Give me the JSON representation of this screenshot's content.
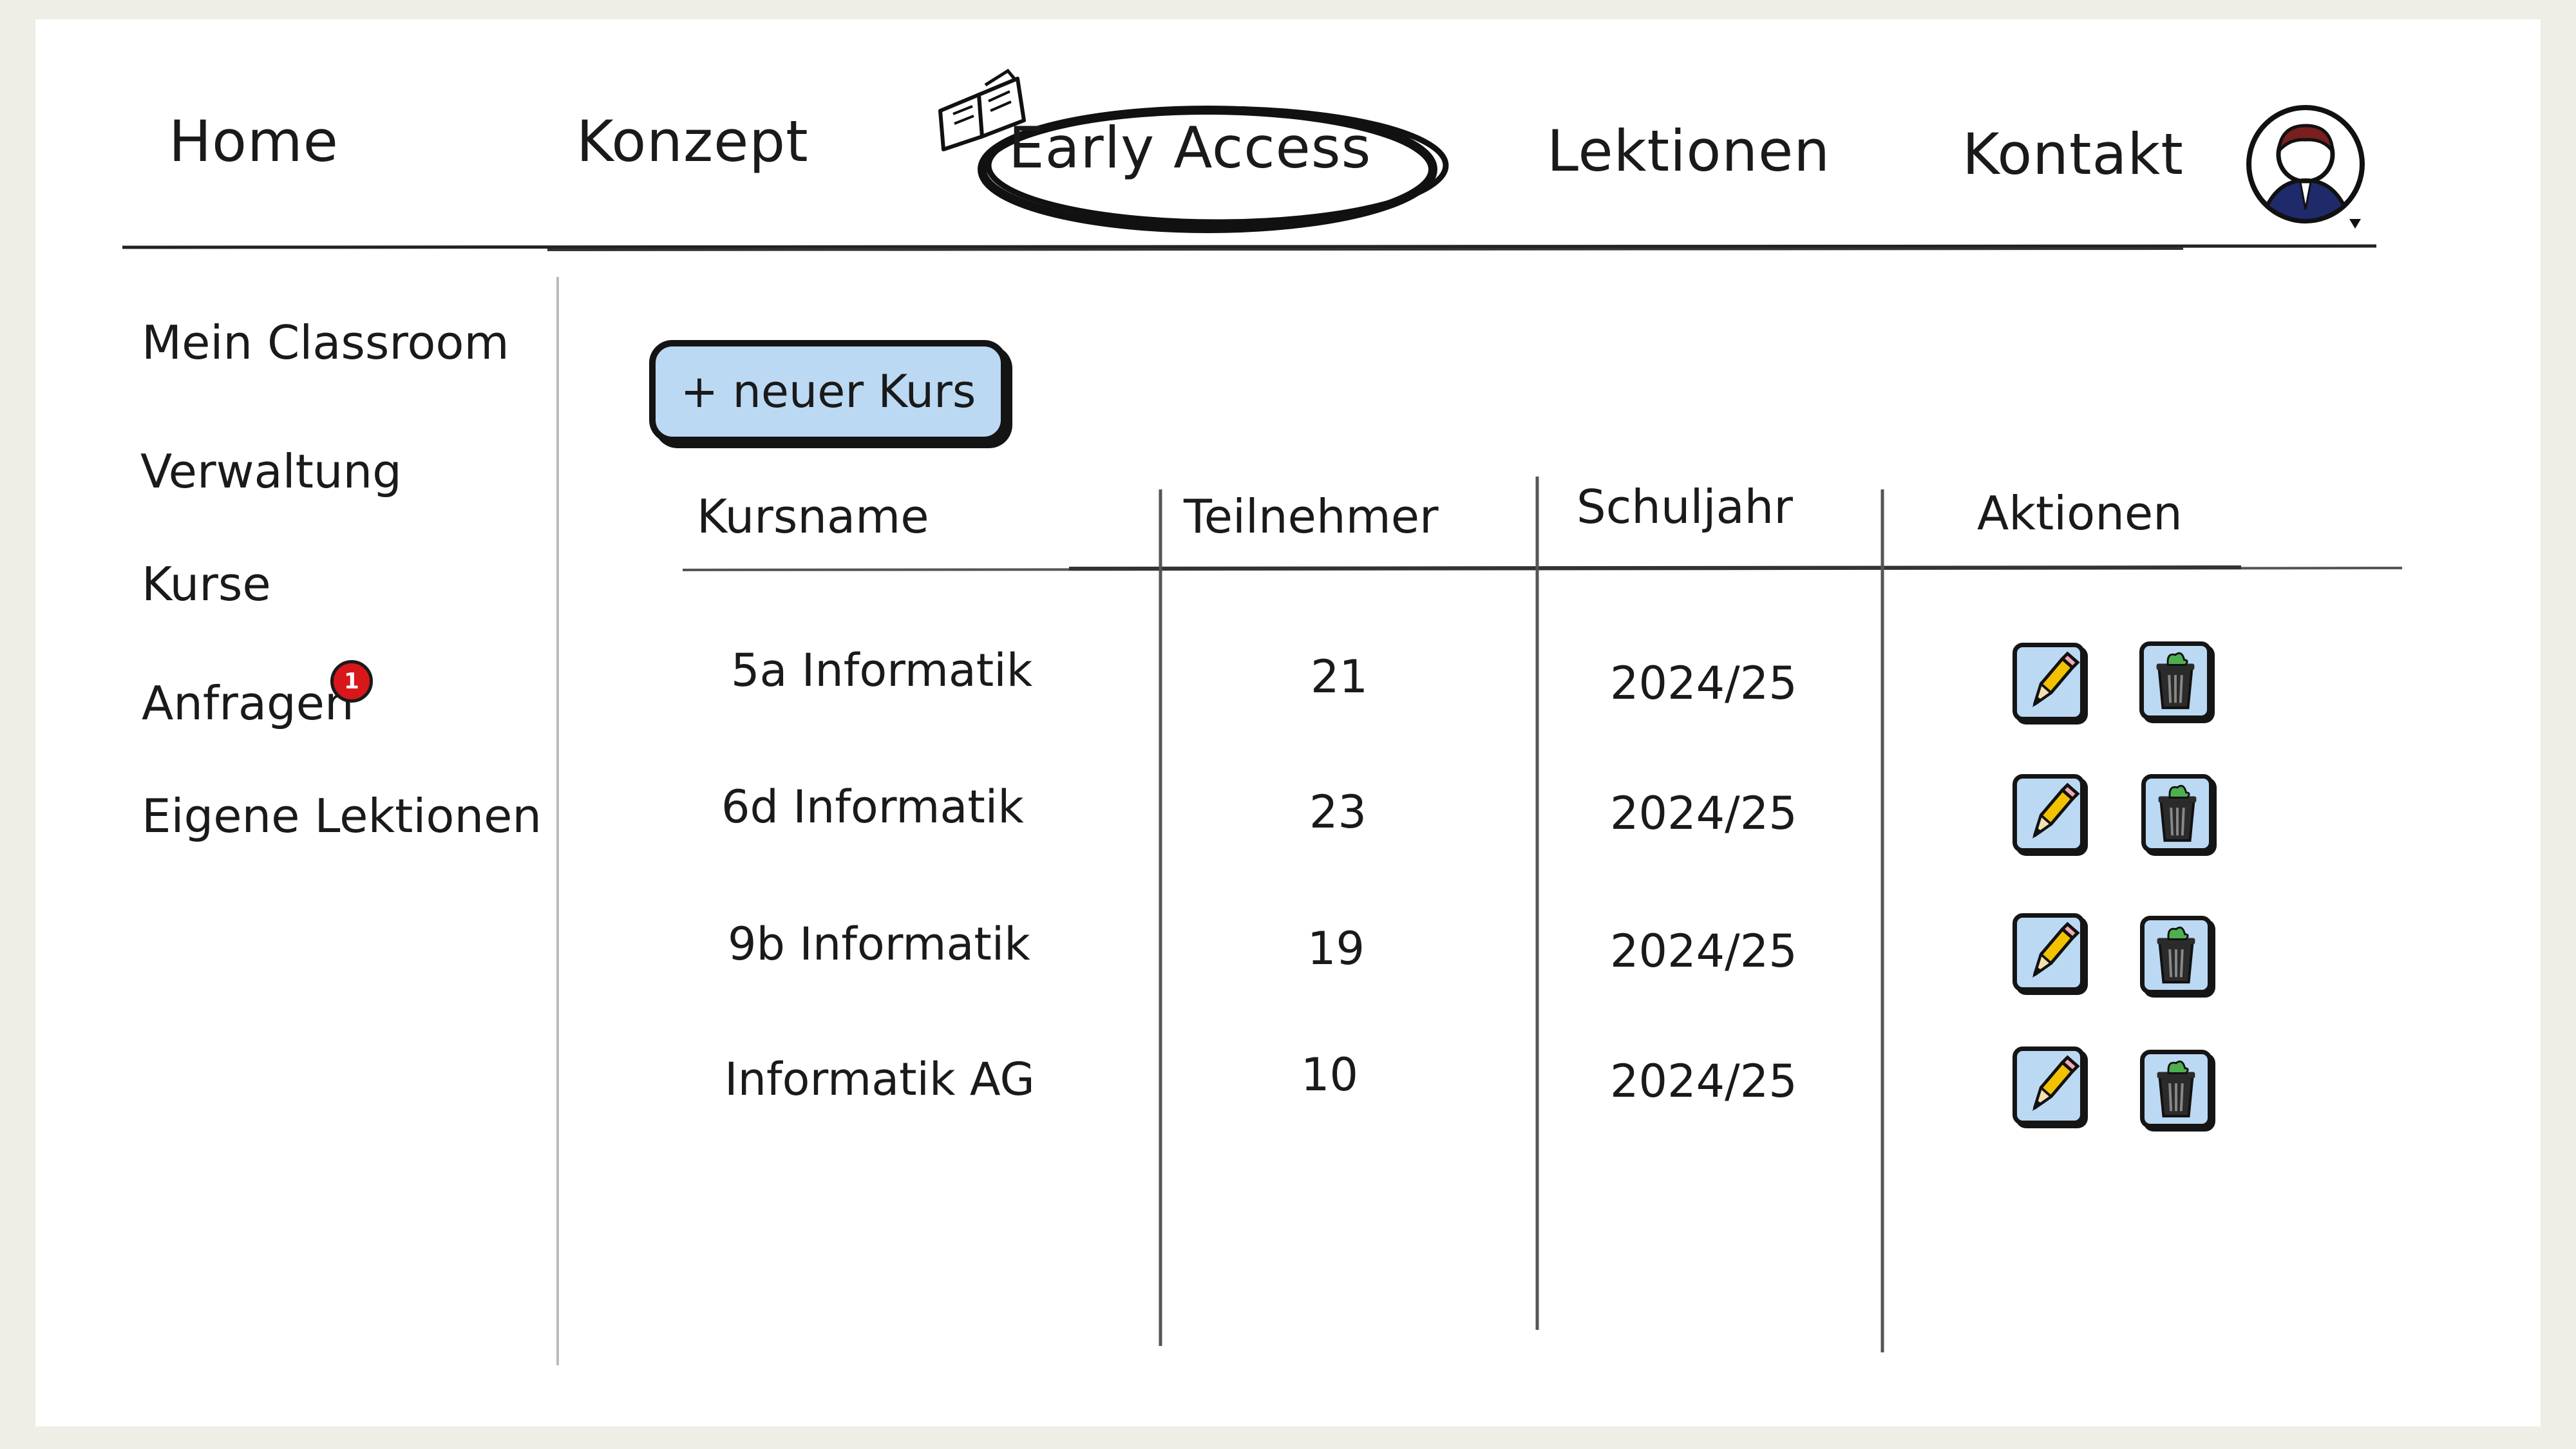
{
  "nav": {
    "home": "Home",
    "konzept": "Konzept",
    "early_access": "Early Access",
    "lektionen": "Lektionen",
    "kontakt": "Kontakt"
  },
  "sidebar": {
    "items": [
      {
        "label": "Mein Classroom"
      },
      {
        "label": "Verwaltung"
      },
      {
        "label": "Kurse"
      },
      {
        "label": "Anfragen",
        "badge": "1"
      },
      {
        "label": "Eigene Lektionen"
      }
    ]
  },
  "toolbar": {
    "new_course": "+ neuer Kurs"
  },
  "table": {
    "headers": [
      "Kursname",
      "Teilnehmer",
      "Schuljahr",
      "Aktionen"
    ],
    "rows": [
      {
        "name": "5a Informatik",
        "participants": "21",
        "year": "2024/25"
      },
      {
        "name": "6d Informatik",
        "participants": "23",
        "year": "2024/25"
      },
      {
        "name": "9b Informatik",
        "participants": "19",
        "year": "2024/25"
      },
      {
        "name": "Informatik AG",
        "participants": "10",
        "year": "2024/25"
      }
    ]
  },
  "icons": {
    "edit": "pencil-icon",
    "delete": "trash-icon",
    "avatar": "user-avatar-icon",
    "book": "book-icon"
  },
  "colors": {
    "accent_blue": "#bcd9f3",
    "badge_red": "#d8171b",
    "pencil_yellow": "#f2c200",
    "trash_green": "#4caf50"
  }
}
